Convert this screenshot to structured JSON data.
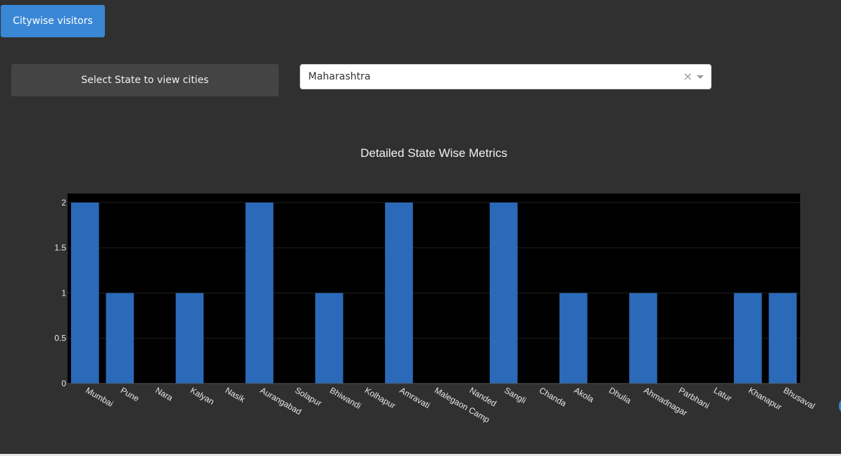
{
  "header": {
    "button_label": "Citywise visitors"
  },
  "controls": {
    "state_label": "Select State to view cities",
    "selected_state": "Maharashtra",
    "clear_symbol": "×"
  },
  "chart_data": {
    "type": "bar",
    "title": "Detailed State Wise Metrics",
    "xlabel": "",
    "ylabel": "",
    "categories": [
      "Mumbai",
      "Pune",
      "Nara",
      "Kalyan",
      "Nasik",
      "Aurangabad",
      "Solapur",
      "Bhiwandi",
      "Kolhapur",
      "Amravati",
      "Malegaon Camp",
      "Nanded",
      "Sangli",
      "Chanda",
      "Akola",
      "Dhulia",
      "Ahmadnagar",
      "Parbhani",
      "Latur",
      "Khanapur",
      "Bhusaval"
    ],
    "values": [
      2,
      1,
      0,
      1,
      0,
      2,
      0,
      1,
      0,
      2,
      0,
      0,
      2,
      0,
      1,
      0,
      1,
      0,
      0,
      1,
      1
    ],
    "ylim": [
      0,
      2.1
    ],
    "yticks": [
      0,
      0.5,
      1,
      1.5,
      2
    ],
    "ytick_labels": [
      "0",
      "0.5",
      "1",
      "1.5",
      "2"
    ],
    "bar_color": "#2a6ab8",
    "plot_background": "#000000",
    "paper_background": "#303030",
    "grid": true
  }
}
